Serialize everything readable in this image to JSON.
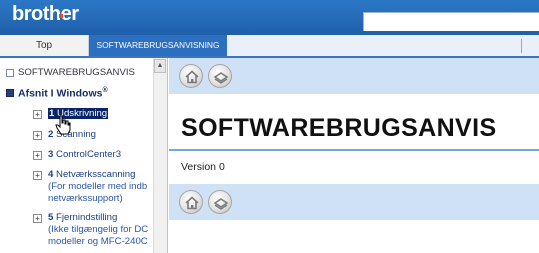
{
  "header": {
    "logo": "brother"
  },
  "tabs": {
    "top_label": "Top",
    "active_label": "SOFTWAREBRUGSANVISNING"
  },
  "sidebar": {
    "root_label": "SOFTWAREBRUGSANVIS",
    "section_label": "Afsnit I Windows",
    "section_sup": "®",
    "items": [
      {
        "num": "1",
        "label": "Udskrivning",
        "selected": true
      },
      {
        "num": "2",
        "label": "Scanning"
      },
      {
        "num": "3",
        "label": "ControlCenter3"
      },
      {
        "num": "4",
        "label": "Netværksscanning",
        "extra": [
          "(For modeller med indb",
          "netværkssupport)"
        ]
      },
      {
        "num": "5",
        "label": "Fjernindstilling",
        "extra": [
          "(Ikke tilgængelig for DC",
          "modeller og MFC-240C"
        ]
      }
    ]
  },
  "main": {
    "title": "SOFTWAREBRUGSANVIS",
    "version": "Version 0"
  },
  "colors": {
    "brand_blue": "#2c6ec0",
    "nav_bg": "#cfe2f5",
    "selected_bg": "#0a246a"
  },
  "icons": {
    "home": "home-icon",
    "tray": "tray-icon"
  }
}
